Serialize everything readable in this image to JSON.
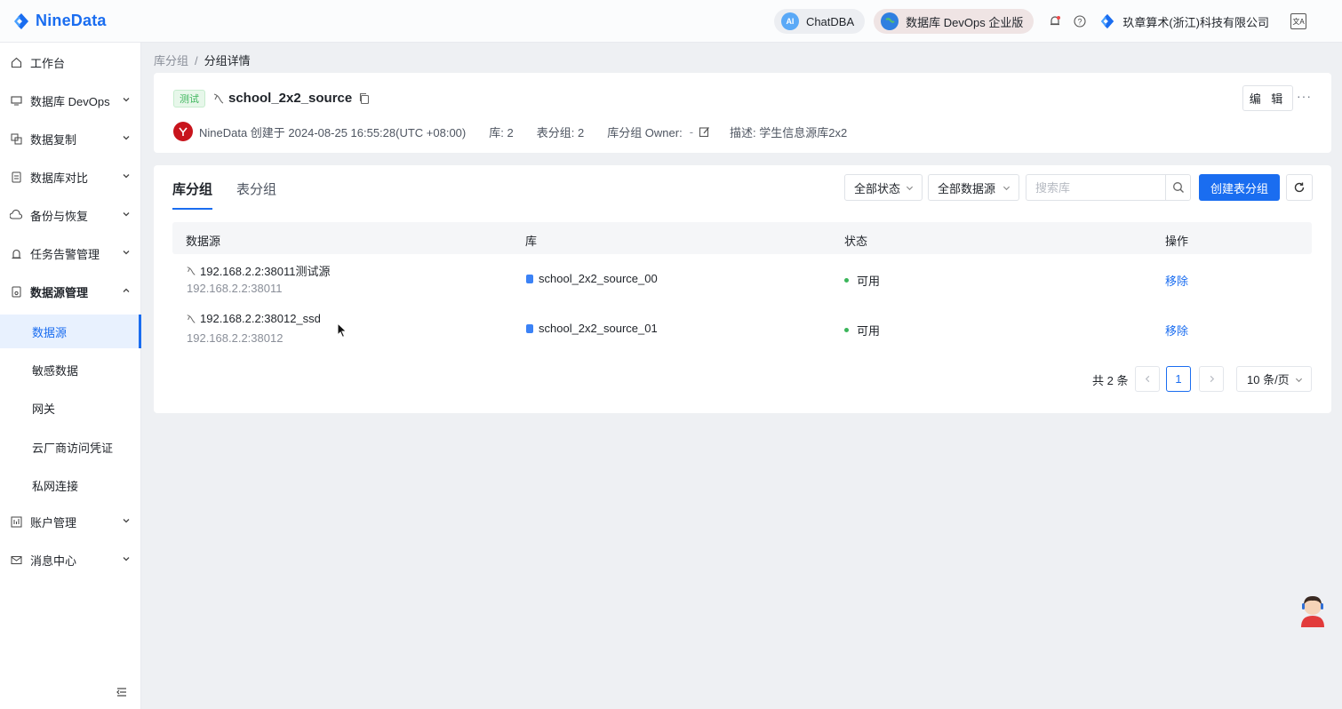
{
  "brand": {
    "name": "NineData",
    "color": "#1a6df0"
  },
  "topbar": {
    "chatdba": "ChatDBA",
    "devops": "数据库 DevOps 企业版",
    "company": "玖章算术(浙江)科技有限公司",
    "icons": [
      "bell-icon",
      "help-icon",
      "language-icon"
    ]
  },
  "sidebar": {
    "items": [
      {
        "label": "工作台",
        "icon": "home-icon"
      },
      {
        "label": "数据库 DevOps",
        "icon": "monitor-icon"
      },
      {
        "label": "数据复制",
        "icon": "copy-icon"
      },
      {
        "label": "数据库对比",
        "icon": "compare-icon"
      },
      {
        "label": "备份与恢复",
        "icon": "cloud-icon"
      },
      {
        "label": "任务告警管理",
        "icon": "alarm-icon"
      },
      {
        "label": "数据源管理",
        "icon": "datasource-icon"
      },
      {
        "label": "账户管理",
        "icon": "account-icon"
      },
      {
        "label": "消息中心",
        "icon": "mail-icon"
      }
    ],
    "sub_items": [
      {
        "label": "数据源",
        "active": true
      },
      {
        "label": "敏感数据"
      },
      {
        "label": "网关"
      },
      {
        "label": "云厂商访问凭证"
      },
      {
        "label": "私网连接"
      }
    ]
  },
  "breadcrumb": {
    "parent": "库分组",
    "sep": "/",
    "current": "分组详情"
  },
  "group": {
    "env_tag": "测试",
    "name": "school_2x2_source",
    "created_by": "NineData 创建于 2024-08-25 16:55:28(UTC +08:00)",
    "db_count": "库: 2",
    "table_group_count": "表分组: 2",
    "owner": "库分组 Owner:",
    "owner_value": "-",
    "description": "描述: 学生信息源库2x2",
    "edit_label": "编 辑",
    "more_label": "···"
  },
  "tabs": [
    {
      "label": "库分组",
      "active": true
    },
    {
      "label": "表分组",
      "active": false
    }
  ],
  "toolbar": {
    "status_filter": "全部状态",
    "source_filter": "全部数据源",
    "search_placeholder": "搜索库",
    "create_label": "创建表分组"
  },
  "table": {
    "columns": [
      "数据源",
      "库",
      "状态",
      "操作"
    ],
    "rows": [
      {
        "source_name": "192.168.2.2:38011测试源",
        "source_addr": "192.168.2.2:38011",
        "database": "school_2x2_source_00",
        "status": "可用",
        "action": "移除"
      },
      {
        "source_name": "192.168.2.2:38012_ssd",
        "source_addr": "192.168.2.2:38012",
        "database": "school_2x2_source_01",
        "status": "可用",
        "action": "移除"
      }
    ]
  },
  "pagination": {
    "total": "共 2 条",
    "current_page": "1",
    "page_size": "10 条/页"
  }
}
